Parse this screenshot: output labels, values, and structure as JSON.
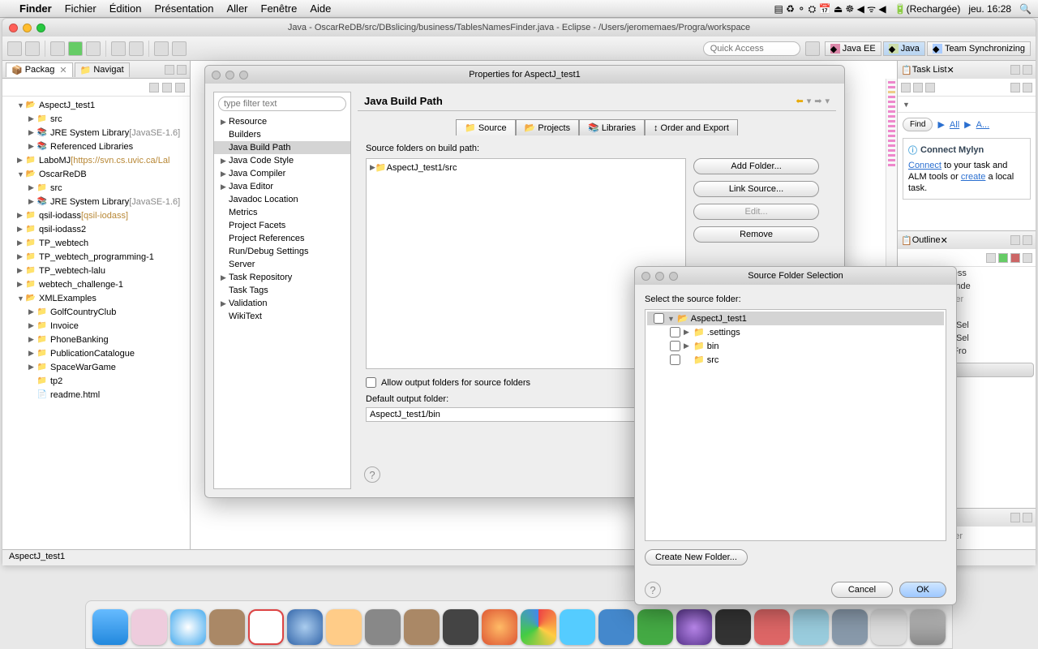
{
  "menubar": {
    "app": "Finder",
    "items": [
      "Fichier",
      "Édition",
      "Présentation",
      "Aller",
      "Fenêtre",
      "Aide"
    ],
    "battery": "(Rechargée)",
    "clock": "jeu. 16:28"
  },
  "eclipse": {
    "title": "Java - OscarReDB/src/DBslicing/business/TablesNamesFinder.java - Eclipse - /Users/jeromemaes/Progra/workspace",
    "quick_access_placeholder": "Quick Access",
    "perspectives": [
      "Java EE",
      "Java",
      "Team Synchronizing"
    ]
  },
  "package_view": {
    "tab1": "Packag",
    "tab2": "Navigat",
    "projects": [
      {
        "lvl": 0,
        "arr": "▼",
        "icon": "📂",
        "label": "AspectJ_test1",
        "cls": ""
      },
      {
        "lvl": 1,
        "arr": "▶",
        "icon": "📁",
        "label": "src",
        "cls": ""
      },
      {
        "lvl": 1,
        "arr": "▶",
        "icon": "📚",
        "label": "JRE System Library ",
        "suffix": "[JavaSE-1.6]",
        "cls": "grey"
      },
      {
        "lvl": 1,
        "arr": "▶",
        "icon": "📚",
        "label": "Referenced Libraries",
        "cls": ""
      },
      {
        "lvl": 0,
        "arr": "▶",
        "icon": "📁",
        "label": "LaboMJ ",
        "suffix": "[https://svn.cs.uvic.ca/Lal",
        "cls": "svntxt"
      },
      {
        "lvl": 0,
        "arr": "▼",
        "icon": "📂",
        "label": "OscarReDB",
        "cls": ""
      },
      {
        "lvl": 1,
        "arr": "▶",
        "icon": "📁",
        "label": "src",
        "cls": ""
      },
      {
        "lvl": 1,
        "arr": "▶",
        "icon": "📚",
        "label": "JRE System Library ",
        "suffix": "[JavaSE-1.6]",
        "cls": "grey"
      },
      {
        "lvl": 0,
        "arr": "▶",
        "icon": "📁",
        "label": "qsil-iodass ",
        "suffix": "[qsil-iodass]",
        "cls": "svntxt"
      },
      {
        "lvl": 0,
        "arr": "▶",
        "icon": "📁",
        "label": "qsil-iodass2",
        "cls": ""
      },
      {
        "lvl": 0,
        "arr": "▶",
        "icon": "📁",
        "label": "TP_webtech",
        "cls": ""
      },
      {
        "lvl": 0,
        "arr": "▶",
        "icon": "📁",
        "label": "TP_webtech_programming-1",
        "cls": ""
      },
      {
        "lvl": 0,
        "arr": "▶",
        "icon": "📁",
        "label": "TP_webtech-lalu",
        "cls": ""
      },
      {
        "lvl": 0,
        "arr": "▶",
        "icon": "📁",
        "label": "webtech_challenge-1",
        "cls": ""
      },
      {
        "lvl": 0,
        "arr": "▼",
        "icon": "📂",
        "label": "XMLExamples",
        "cls": ""
      },
      {
        "lvl": 1,
        "arr": "▶",
        "icon": "📁",
        "label": "GolfCountryClub",
        "cls": ""
      },
      {
        "lvl": 1,
        "arr": "▶",
        "icon": "📁",
        "label": "Invoice",
        "cls": ""
      },
      {
        "lvl": 1,
        "arr": "▶",
        "icon": "📁",
        "label": "PhoneBanking",
        "cls": ""
      },
      {
        "lvl": 1,
        "arr": "▶",
        "icon": "📁",
        "label": "PublicationCatalogue",
        "cls": ""
      },
      {
        "lvl": 1,
        "arr": "▶",
        "icon": "📁",
        "label": "SpaceWarGame",
        "cls": ""
      },
      {
        "lvl": 1,
        "arr": "",
        "icon": "📁",
        "label": "tp2",
        "cls": ""
      },
      {
        "lvl": 1,
        "arr": "",
        "icon": "📄",
        "label": "readme.html",
        "cls": ""
      }
    ]
  },
  "statusbar": {
    "text": "AspectJ_test1"
  },
  "properties": {
    "title": "Properties for AspectJ_test1",
    "filter_placeholder": "type filter text",
    "categories": [
      {
        "arr": "▶",
        "label": "Resource"
      },
      {
        "arr": "",
        "label": "Builders"
      },
      {
        "arr": "",
        "label": "Java Build Path",
        "sel": true
      },
      {
        "arr": "▶",
        "label": "Java Code Style"
      },
      {
        "arr": "▶",
        "label": "Java Compiler"
      },
      {
        "arr": "▶",
        "label": "Java Editor"
      },
      {
        "arr": "",
        "label": "Javadoc Location"
      },
      {
        "arr": "",
        "label": "Metrics"
      },
      {
        "arr": "",
        "label": "Project Facets"
      },
      {
        "arr": "",
        "label": "Project References"
      },
      {
        "arr": "",
        "label": "Run/Debug Settings"
      },
      {
        "arr": "",
        "label": "Server"
      },
      {
        "arr": "▶",
        "label": "Task Repository"
      },
      {
        "arr": "",
        "label": "Task Tags"
      },
      {
        "arr": "▶",
        "label": "Validation"
      },
      {
        "arr": "",
        "label": "WikiText"
      }
    ],
    "page_title": "Java Build Path",
    "tabs": [
      "Source",
      "Projects",
      "Libraries",
      "Order and Export"
    ],
    "source_label": "Source folders on build path:",
    "source_entry": "AspectJ_test1/src",
    "buttons": {
      "add": "Add Folder...",
      "link": "Link Source...",
      "edit": "Edit...",
      "remove": "Remove"
    },
    "allow_output": "Allow output folders for source folders",
    "output_label": "Default output folder:",
    "output_value": "AspectJ_test1/bin"
  },
  "source_selection": {
    "title": "Source Folder Selection",
    "label": "Select the source folder:",
    "tree": [
      {
        "lvl": 0,
        "checked": false,
        "arr": "▼",
        "icon": "📂",
        "label": "AspectJ_test1",
        "sel": true
      },
      {
        "lvl": 1,
        "checked": false,
        "arr": "▶",
        "icon": "📁",
        "label": ".settings"
      },
      {
        "lvl": 1,
        "checked": false,
        "arr": "▶",
        "icon": "📁",
        "label": "bin"
      },
      {
        "lvl": 1,
        "checked": false,
        "arr": "",
        "icon": "📁",
        "label": "src"
      }
    ],
    "create_btn": "Create New Folder...",
    "cancel": "Cancel",
    "ok": "OK"
  },
  "tasklist": {
    "tab": "Task List",
    "find": "Find",
    "all": "All",
    "activate": "A...",
    "mylyn_title": "Connect Mylyn",
    "mylyn_text_pre": "",
    "mylyn_link1": "Connect",
    "mylyn_text_mid": " to your task and ALM tools or ",
    "mylyn_link2": "create",
    "mylyn_text_end": " a local task."
  },
  "outline": {
    "tab": "Outline",
    "items": [
      {
        "label": "icing.business",
        "cls": ""
      },
      {
        "label": "esNamesFinde",
        "cls": ""
      },
      {
        "label": "gger : Logger",
        "cls": "grey"
      },
      {
        "label": "bles : List",
        "cls": "grey"
      },
      {
        "label": "etTableList(Sel",
        "cls": ""
      },
      {
        "label": "etTableList(Sel",
        "cls": ""
      },
      {
        "label": "etTableListFro",
        "cls": ""
      }
    ],
    "drop_hint": "pp the member"
  }
}
